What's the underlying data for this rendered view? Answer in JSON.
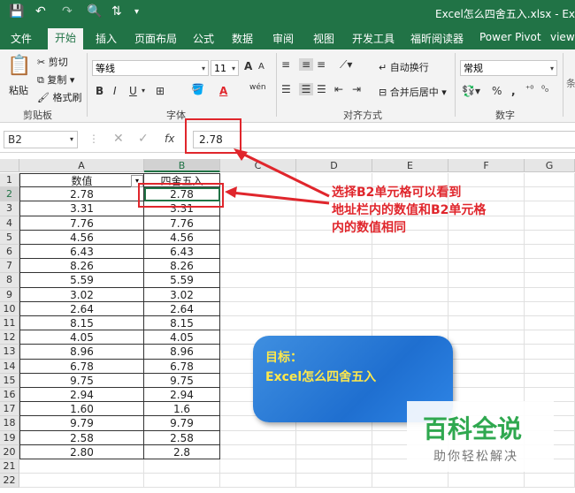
{
  "titlebar": {
    "title": "Excel怎么四舍五入.xlsx  -  Exc",
    "icons": [
      "save-icon",
      "undo-icon",
      "redo-icon",
      "print-preview-icon",
      "sort-icon",
      "customize-qat-icon"
    ]
  },
  "tabs": [
    "文件",
    "开始",
    "插入",
    "页面布局",
    "公式",
    "数据",
    "审阅",
    "视图",
    "开发工具",
    "福昕阅读器",
    "Power Pivot",
    "view"
  ],
  "active_tab": "开始",
  "ribbon": {
    "clipboard": {
      "paste": "粘贴",
      "cut": "剪切",
      "copy": "复制",
      "format_painter": "格式刷",
      "group": "剪贴板"
    },
    "font": {
      "name": "等线",
      "size": "11",
      "group": "字体",
      "bold": "B",
      "italic": "I",
      "underline": "U",
      "grow": "A",
      "shrink": "A",
      "wen": "wén"
    },
    "alignment": {
      "wrap": "自动换行",
      "merge": "合并后居中",
      "group": "对齐方式"
    },
    "number": {
      "format": "常规",
      "percent": "%",
      "comma": ",",
      "group": "数字"
    }
  },
  "formula_bar": {
    "name_box": "B2",
    "fx": "fx",
    "value": "2.78"
  },
  "columns": [
    "A",
    "B",
    "C",
    "D",
    "E",
    "F",
    "G"
  ],
  "sheet": {
    "header_a": "数值",
    "header_b": "四舍五入",
    "a_values": [
      "2.78",
      "3.31",
      "7.76",
      "4.56",
      "6.43",
      "8.26",
      "5.59",
      "3.02",
      "2.64",
      "8.15",
      "4.05",
      "8.96",
      "6.78",
      "9.75",
      "2.94",
      "1.60",
      "9.79",
      "2.58",
      "2.80"
    ],
    "b_values": [
      "2.78",
      "3.31",
      "7.76",
      "4.56",
      "6.43",
      "8.26",
      "5.59",
      "3.02",
      "2.64",
      "8.15",
      "4.05",
      "8.96",
      "6.78",
      "9.75",
      "2.94",
      "1.6",
      "9.79",
      "2.58",
      "2.8"
    ],
    "row_count": 22
  },
  "annotation": {
    "lines": [
      "选择B2单元格可以看到",
      "地址栏内的数值和B2单元格",
      "内的数值相同"
    ],
    "color": "#e0262c"
  },
  "goal_box": {
    "line1": "目标：",
    "line2": "Excel怎么四舍五入"
  },
  "watermark": {
    "big": "百科全说",
    "small": "助你轻松解决"
  },
  "colors": {
    "excel_green": "#217346",
    "accent_red": "#e0262c"
  }
}
